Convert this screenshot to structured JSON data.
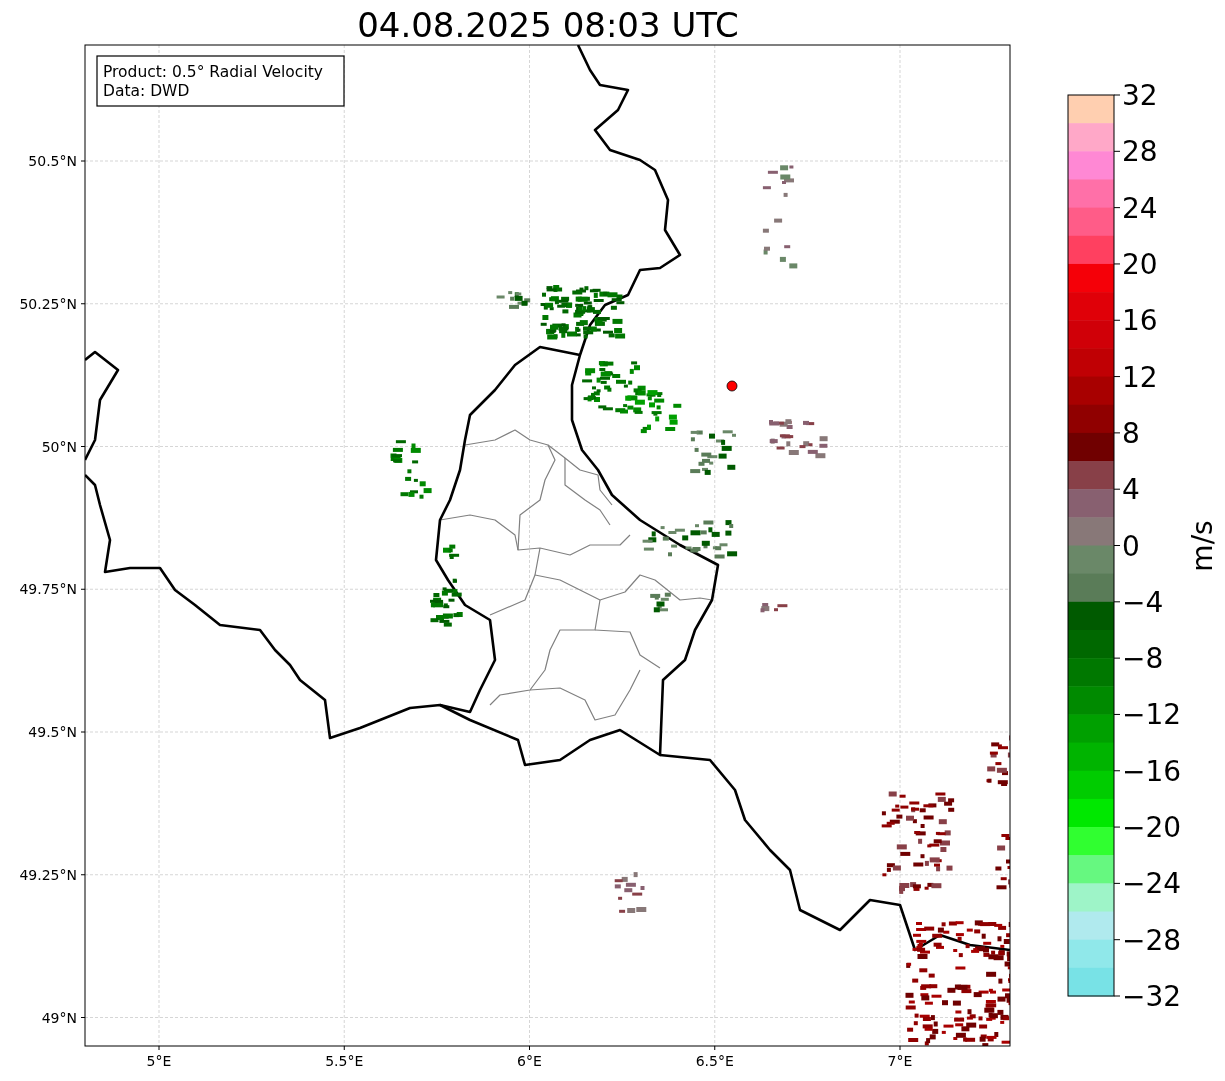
{
  "title": "04.08.2025 08:03 UTC",
  "info_box": {
    "lines": [
      "Product: 0.5° Radial Velocity",
      "Data: DWD"
    ]
  },
  "map": {
    "xtick_labels": [
      "5°E",
      "5.5°E",
      "6°E",
      "6.5°E",
      "7°E"
    ],
    "ytick_labels": [
      "50.5°N",
      "50.25°N",
      "50°N",
      "49.75°N",
      "49.5°N",
      "49.25°N",
      "49°N"
    ]
  },
  "colorbar": {
    "label": "m/s",
    "tick_labels": [
      "32",
      "28",
      "24",
      "20",
      "16",
      "12",
      "8",
      "4",
      "0",
      "−4",
      "−8",
      "−12",
      "−16",
      "−20",
      "−24",
      "−28",
      "−32"
    ],
    "segments": [
      {
        "color": "#ffcfb0"
      },
      {
        "color": "#ffa8c8"
      },
      {
        "color": "#ff88d4"
      },
      {
        "color": "#ff70a8"
      },
      {
        "color": "#ff5c88"
      },
      {
        "color": "#ff4060"
      },
      {
        "color": "#f50008"
      },
      {
        "color": "#e00008"
      },
      {
        "color": "#d00008"
      },
      {
        "color": "#c00004"
      },
      {
        "color": "#a80000"
      },
      {
        "color": "#900000"
      },
      {
        "color": "#700000"
      },
      {
        "color": "#884048"
      },
      {
        "color": "#886070"
      },
      {
        "color": "#887878"
      },
      {
        "color": "#6a8868"
      },
      {
        "color": "#5a7c58"
      },
      {
        "color": "#005a00"
      },
      {
        "color": "#006800"
      },
      {
        "color": "#007800"
      },
      {
        "color": "#008a00"
      },
      {
        "color": "#00a000"
      },
      {
        "color": "#00b400"
      },
      {
        "color": "#00cc00"
      },
      {
        "color": "#00e800"
      },
      {
        "color": "#30ff30"
      },
      {
        "color": "#66f880"
      },
      {
        "color": "#9ef4c8"
      },
      {
        "color": "#b0eaee"
      },
      {
        "color": "#90e8ea"
      },
      {
        "color": "#78e2e6"
      }
    ]
  }
}
